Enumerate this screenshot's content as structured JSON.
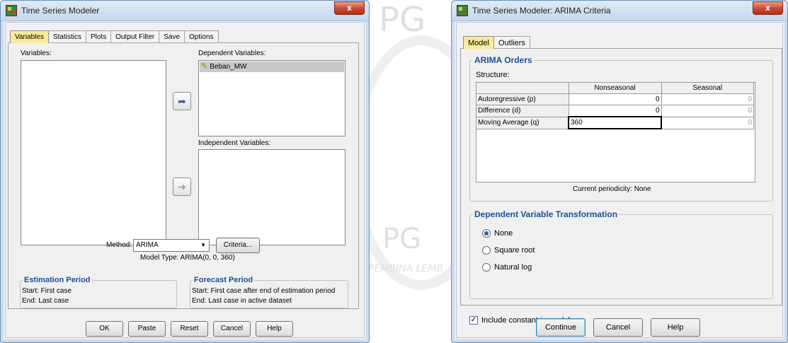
{
  "background": {
    "watermark_text_1": "PG",
    "watermark_text_2": "PG",
    "watermark_text_3": "PEMBINA LEMB"
  },
  "left_dialog": {
    "title": "Time Series Modeler",
    "close_label": "x",
    "tabs": [
      {
        "label": "Variables",
        "active": true
      },
      {
        "label": "Statistics"
      },
      {
        "label": "Plots"
      },
      {
        "label": "Output Filter"
      },
      {
        "label": "Save"
      },
      {
        "label": "Options"
      }
    ],
    "variables_label": "Variables:",
    "dependent_label": "Dependent Variables:",
    "dependent_items": [
      "Beban_MW"
    ],
    "independent_label": "Independent Variables:",
    "method_label": "Method:",
    "method_value": "ARIMA",
    "criteria_button": "Criteria...",
    "model_type": "Model Type: ARIMA(0, 0, 360)",
    "estimation": {
      "title": "Estimation Period",
      "start": "Start:  First case",
      "end": "End:   Last case"
    },
    "forecast": {
      "title": "Forecast Period",
      "start": "Start:  First case after end of estimation period",
      "end": "End:   Last case in active dataset"
    },
    "buttons": {
      "ok": "OK",
      "paste": "Paste",
      "reset": "Reset",
      "cancel": "Cancel",
      "help": "Help"
    }
  },
  "right_dialog": {
    "title": "Time Series Modeler: ARIMA Criteria",
    "close_label": "x",
    "tabs": [
      {
        "label": "Model",
        "active": true
      },
      {
        "label": "Outliers"
      }
    ],
    "arima_orders_title": "ARIMA Orders",
    "structure_label": "Structure:",
    "grid": {
      "columns": [
        "Nonseasonal",
        "Seasonal"
      ],
      "rows": [
        {
          "label": "Autoregressive (p)",
          "nonseasonal": "0",
          "seasonal": "0"
        },
        {
          "label": "Difference (d)",
          "nonseasonal": "0",
          "seasonal": "0"
        },
        {
          "label": "Moving Average (q)",
          "nonseasonal": "360",
          "seasonal": "0"
        }
      ]
    },
    "periodicity": "Current periodicity: None",
    "transform": {
      "title": "Dependent Variable Transformation",
      "options": [
        "None",
        "Square root",
        "Natural log"
      ],
      "selected": "None"
    },
    "include_constant": {
      "label": "Include constant in model",
      "checked": true
    },
    "buttons": {
      "continue": "Continue",
      "cancel": "Cancel",
      "help": "Help"
    }
  }
}
